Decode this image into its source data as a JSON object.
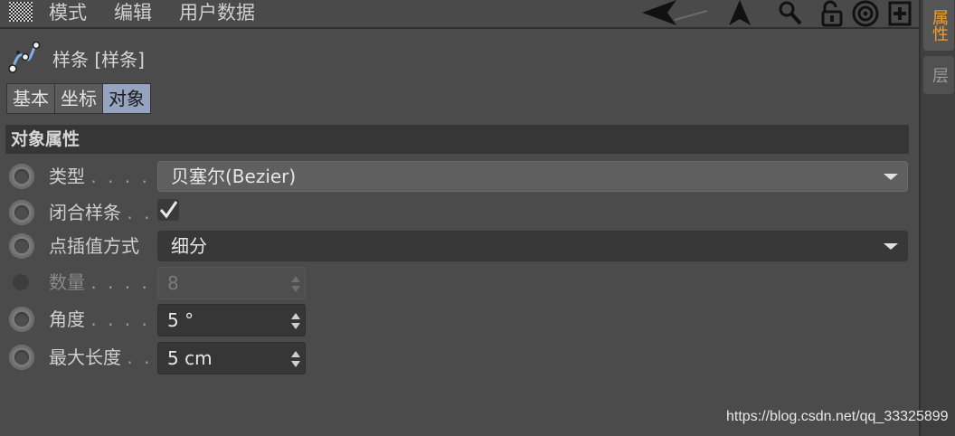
{
  "menubar": {
    "items": [
      "模式",
      "编辑",
      "用户数据"
    ]
  },
  "icons": {
    "grid": "grid-icon",
    "back_arrow": "back-arrow-icon",
    "up_arrow": "up-arrow-icon",
    "search": "search-icon",
    "lock": "unlock-icon",
    "target": "target-icon",
    "add": "add-panel-icon"
  },
  "side_tabs": {
    "active": "属性",
    "inactive": "层"
  },
  "object": {
    "title": "样条 [样条]",
    "icon": "spline-icon"
  },
  "tabs": [
    "基本",
    "坐标",
    "对象"
  ],
  "active_tab_index": 2,
  "section": {
    "title": "对象属性"
  },
  "params": {
    "type": {
      "label": "类型",
      "dots": ". . . . . .",
      "value": "贝塞尔(Bezier)"
    },
    "close": {
      "label": "闭合样条",
      "dots": ". .",
      "checked": true,
      "check_glyph": "✔"
    },
    "interp": {
      "label": "点插值方式",
      "value": "细分"
    },
    "count": {
      "label": "数量",
      "dots": ". . . . . . .",
      "value": "8",
      "enabled": false
    },
    "angle": {
      "label": "角度",
      "dots": ". . . . . . .",
      "value": "5 °"
    },
    "maxlen": {
      "label": "最大长度",
      "dots": ". .",
      "value": "5 cm"
    }
  },
  "watermark": "https://blog.csdn.net/qq_33325899",
  "colors": {
    "panel_bg": "#4b4b4b",
    "active_tab": "#96a3be",
    "side_tab_active_text": "#f0a030",
    "field_dark": "#363636"
  }
}
